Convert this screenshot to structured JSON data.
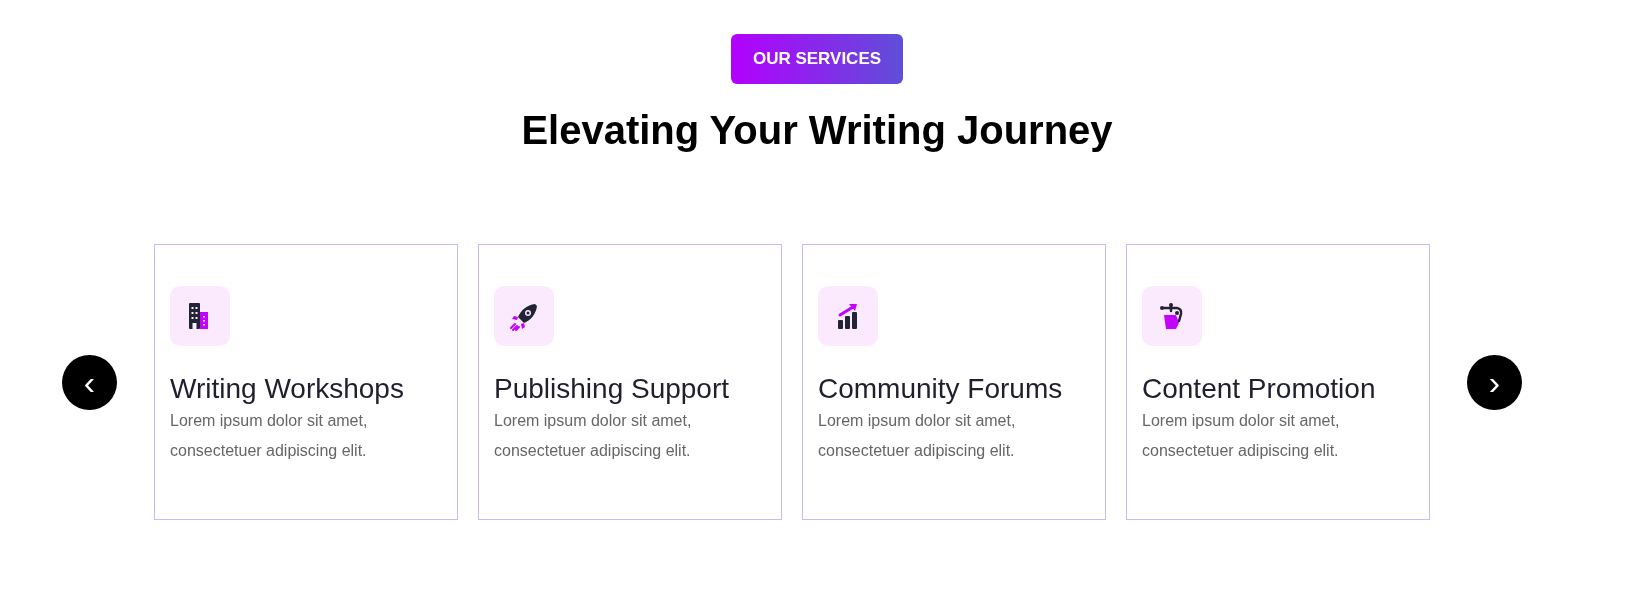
{
  "badge": "OUR SERVICES",
  "heading": "Elevating Your Writing Journey",
  "carousel": {
    "prev": "‹",
    "next": "›"
  },
  "services": [
    {
      "title": "Writing Workshops",
      "description": "Lorem ipsum dolor sit amet, consectetuer adipiscing elit."
    },
    {
      "title": "Publishing Support",
      "description": "Lorem ipsum dolor sit amet, consectetuer adipiscing elit."
    },
    {
      "title": "Community Forums",
      "description": "Lorem ipsum dolor sit amet, consectetuer adipiscing elit."
    },
    {
      "title": "Content Promotion",
      "description": "Lorem ipsum dolor sit amet, consectetuer adipiscing elit."
    }
  ]
}
